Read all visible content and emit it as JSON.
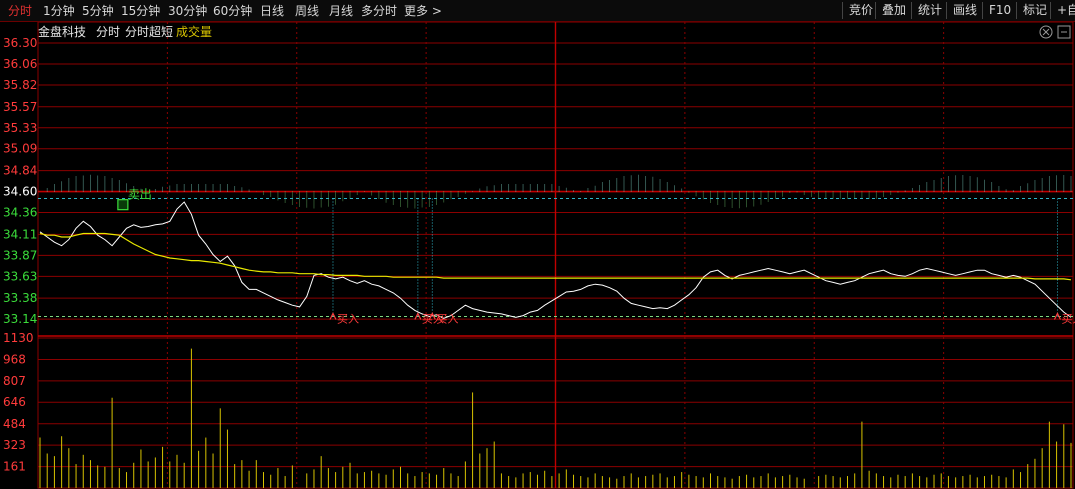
{
  "toolbar": {
    "tabs": [
      "分时",
      "1分钟",
      "5分钟",
      "15分钟",
      "30分钟",
      "60分钟",
      "日线",
      "周线",
      "月线",
      "多分时",
      "更多 >"
    ],
    "right_buttons": [
      "竞价",
      "叠加",
      "统计",
      "画线",
      "F10",
      "标记",
      "+自"
    ]
  },
  "chart_header": {
    "stock_name": "金盘科技",
    "mode": "分时",
    "indicator": "分时超短",
    "sub_label": "成交量"
  },
  "colors": {
    "up_red": "#ff3b3b",
    "down_green": "#3bdc3b",
    "grid_red": "#8b0000",
    "price_line": "#ffffff",
    "avg_line": "#e8e800",
    "volume_bar": "#d8c400",
    "cyan_marker": "#2fb6c8"
  },
  "icons": [
    "close-icon",
    "settings-icon"
  ],
  "chart_data": {
    "type": "line",
    "price_axis_labels": [
      "36.30",
      "36.06",
      "35.82",
      "35.57",
      "35.33",
      "35.09",
      "34.84",
      "34.60",
      "34.36",
      "34.11",
      "33.87",
      "33.63",
      "33.38",
      "33.14"
    ],
    "prev_close": 34.6,
    "ylim": [
      33.05,
      36.3
    ],
    "volume_axis_labels": [
      "1130",
      "968",
      "807",
      "646",
      "484",
      "323",
      "161"
    ],
    "volume_ylim": [
      0,
      1130
    ],
    "signals": [
      {
        "label": "卖出",
        "price": 34.45
      },
      {
        "label": "买入",
        "price": 33.18
      },
      {
        "label": "买入",
        "price": 33.18
      },
      {
        "label": "买入",
        "price": 33.18
      },
      {
        "label": "买入",
        "price": 33.18
      }
    ],
    "price": [
      34.14,
      34.08,
      34.02,
      33.98,
      34.05,
      34.18,
      34.26,
      34.2,
      34.1,
      34.05,
      33.98,
      34.08,
      34.18,
      34.22,
      34.19,
      34.2,
      34.22,
      34.23,
      34.26,
      34.4,
      34.48,
      34.34,
      34.1,
      34.0,
      33.88,
      33.8,
      33.86,
      33.75,
      33.56,
      33.48,
      33.48,
      33.44,
      33.4,
      33.36,
      33.33,
      33.3,
      33.28,
      33.4,
      33.64,
      33.66,
      33.62,
      33.6,
      33.62,
      33.58,
      33.55,
      33.58,
      33.54,
      33.52,
      33.48,
      33.44,
      33.38,
      33.3,
      33.24,
      33.2,
      33.17,
      33.19,
      33.15,
      33.18,
      33.24,
      33.3,
      33.26,
      33.24,
      33.22,
      33.21,
      33.2,
      33.18,
      33.16,
      33.18,
      33.22,
      33.24,
      33.3,
      33.35,
      33.4,
      33.45,
      33.46,
      33.48,
      33.52,
      33.54,
      33.53,
      33.5,
      33.46,
      33.38,
      33.32,
      33.3,
      33.28,
      33.26,
      33.27,
      33.26,
      33.3,
      33.36,
      33.42,
      33.5,
      33.62,
      33.68,
      33.7,
      33.64,
      33.6,
      33.64,
      33.66,
      33.68,
      33.7,
      33.72,
      33.7,
      33.68,
      33.66,
      33.68,
      33.7,
      33.66,
      33.62,
      33.58,
      33.56,
      33.54,
      33.56,
      33.58,
      33.62,
      33.66,
      33.68,
      33.7,
      33.66,
      33.64,
      33.63,
      33.66,
      33.7,
      33.72,
      33.7,
      33.68,
      33.66,
      33.64,
      33.66,
      33.68,
      33.7,
      33.7,
      33.66,
      33.64,
      33.62,
      33.64,
      33.62,
      33.58,
      33.54,
      33.46,
      33.38,
      33.3,
      33.22,
      33.16
    ],
    "avg": [
      34.12,
      34.1,
      34.1,
      34.08,
      34.08,
      34.1,
      34.12,
      34.12,
      34.12,
      34.12,
      34.11,
      34.1,
      34.05,
      34.0,
      33.96,
      33.92,
      33.88,
      33.86,
      33.84,
      33.83,
      33.82,
      33.81,
      33.81,
      33.8,
      33.79,
      33.78,
      33.76,
      33.74,
      33.72,
      33.7,
      33.69,
      33.68,
      33.68,
      33.67,
      33.67,
      33.67,
      33.66,
      33.66,
      33.66,
      33.65,
      33.65,
      33.64,
      33.64,
      33.64,
      33.64,
      33.63,
      33.63,
      33.63,
      33.63,
      33.62,
      33.62,
      33.62,
      33.62,
      33.62,
      33.62,
      33.62,
      33.61,
      33.61,
      33.61,
      33.61,
      33.61,
      33.61,
      33.61,
      33.61,
      33.61,
      33.61,
      33.61,
      33.61,
      33.61,
      33.61,
      33.61,
      33.61,
      33.61,
      33.61,
      33.61,
      33.61,
      33.61,
      33.61,
      33.61,
      33.61,
      33.61,
      33.61,
      33.61,
      33.61,
      33.61,
      33.61,
      33.61,
      33.61,
      33.61,
      33.61,
      33.61,
      33.61,
      33.61,
      33.61,
      33.61,
      33.61,
      33.61,
      33.61,
      33.61,
      33.61,
      33.61,
      33.61,
      33.61,
      33.61,
      33.61,
      33.61,
      33.61,
      33.61,
      33.61,
      33.61,
      33.61,
      33.61,
      33.61,
      33.61,
      33.61,
      33.61,
      33.61,
      33.61,
      33.61,
      33.61,
      33.61,
      33.61,
      33.61,
      33.61,
      33.61,
      33.61,
      33.61,
      33.61,
      33.61,
      33.61,
      33.61,
      33.61,
      33.61,
      33.61,
      33.61,
      33.61,
      33.61,
      33.61,
      33.6,
      33.6,
      33.6,
      33.6,
      33.6,
      33.59
    ],
    "volume": [
      380,
      260,
      240,
      390,
      300,
      180,
      250,
      210,
      170,
      160,
      680,
      150,
      120,
      190,
      290,
      200,
      230,
      310,
      200,
      250,
      190,
      1050,
      280,
      380,
      260,
      600,
      440,
      180,
      210,
      130,
      210,
      120,
      100,
      150,
      90,
      170,
      110,
      140,
      240,
      150,
      120,
      160,
      190,
      110,
      120,
      130,
      110,
      100,
      140,
      160,
      110,
      90,
      120,
      110,
      100,
      150,
      110,
      90,
      200,
      720,
      260,
      300,
      350,
      110,
      90,
      80,
      110,
      120,
      100,
      130,
      90,
      110,
      140,
      100,
      90,
      80,
      110,
      90,
      80,
      70,
      90,
      110,
      80,
      90,
      100,
      110,
      80,
      90,
      120,
      100,
      90,
      80,
      110,
      90,
      80,
      70,
      90,
      100,
      80,
      90,
      110,
      80,
      90,
      100,
      80,
      70,
      90,
      100,
      90,
      80,
      90,
      110,
      500,
      130,
      110,
      90,
      80,
      100,
      90,
      110,
      90,
      80,
      100,
      110,
      90,
      80,
      90,
      100,
      80,
      90,
      100,
      90,
      80,
      140,
      120,
      180,
      220,
      300,
      500,
      350,
      480,
      340
    ]
  }
}
